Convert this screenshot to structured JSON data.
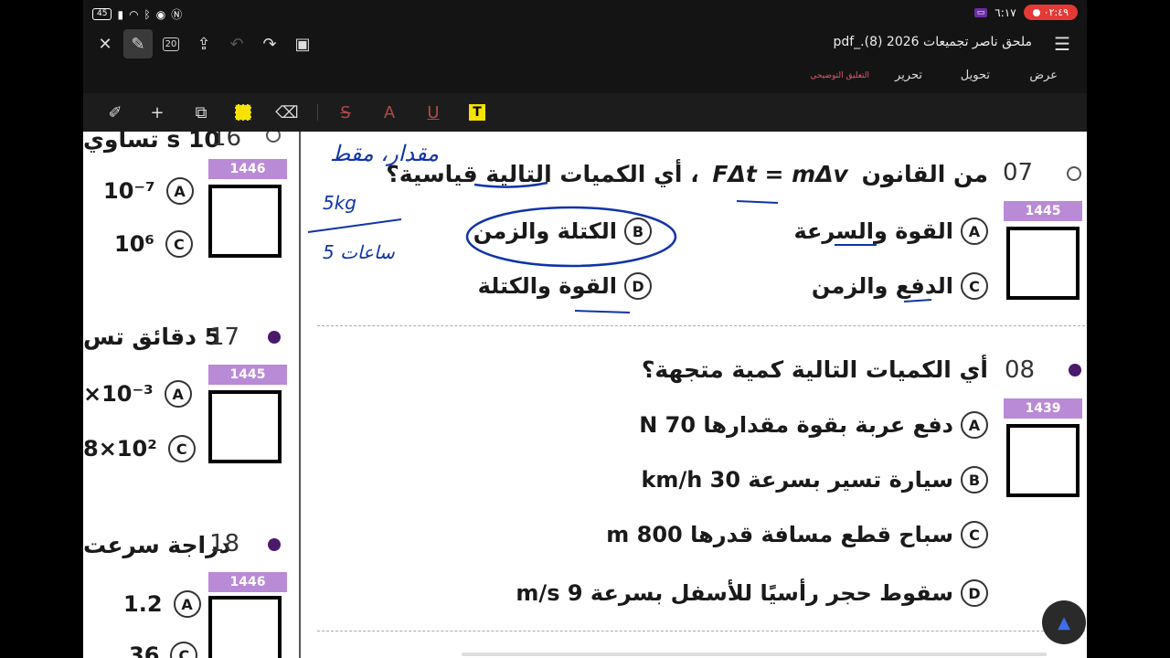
{
  "status": {
    "left_icons": [
      "battery-icon",
      "signal-icon",
      "wifi-icon",
      "bluetooth-icon",
      "eye-icon",
      "nfc-icon"
    ],
    "battery": "45",
    "right_time": "٦:١٧",
    "record_time": "٠٢:٤٩"
  },
  "topbar": {
    "doc_title": "ملحق ناصر تجميعات 2026 (8)._pdf",
    "page_count_icon": "20"
  },
  "tabs": {
    "view": "عرض",
    "convert": "تحويل",
    "edit": "تحرير",
    "annotate": "التعليق التوضيحي"
  },
  "page": {
    "left_column": {
      "q16": {
        "number": "16",
        "text_fragment": "10 s تساوي",
        "tag": "1446",
        "opt_a": "10⁻⁷",
        "opt_c": "10⁶"
      },
      "q17": {
        "number": "17",
        "text_fragment": "5 دقائق تس",
        "tag": "1445",
        "opt_a": "×10⁻³",
        "opt_c": "8×10²"
      },
      "q18": {
        "number": "18",
        "text_fragment": "دراجة سرعت",
        "tag": "1446",
        "opt_a": "1.2",
        "opt_c": "36"
      }
    },
    "q07": {
      "number": "07",
      "tag": "1445",
      "text_prefix": "من القانون",
      "formula": "FΔt = mΔv",
      "text_suffix": "، أي الكميات التالية قياسية؟",
      "options": [
        {
          "letter": "A",
          "text": "القوة والسرعة"
        },
        {
          "letter": "B",
          "text": "الكتلة والزمن"
        },
        {
          "letter": "C",
          "text": "الدفع والزمن"
        },
        {
          "letter": "D",
          "text": "القوة والكتلة"
        }
      ]
    },
    "q08": {
      "number": "08",
      "tag": "1439",
      "text": "أي الكميات التالية كمية متجهة؟",
      "options": [
        {
          "letter": "A",
          "text": "دفع عربة بقوة مقدارها 70 N"
        },
        {
          "letter": "B",
          "text": "سيارة تسير بسرعة 30 km/h"
        },
        {
          "letter": "C",
          "text": "سباح قطع مسافة قدرها 800 m"
        },
        {
          "letter": "D",
          "text": "سقوط حجر رأسيًا للأسفل بسرعة 9 m/s"
        }
      ]
    },
    "ink": {
      "note_top": "مقدار، مقط",
      "note_kg": "5kg",
      "note_bottom": "5 ساعات"
    }
  },
  "colors": {
    "accent_tab": "#e05a6b",
    "bullet": "#4b1a6b",
    "tag_bg": "#b98ad6",
    "ink": "#1034a8"
  }
}
